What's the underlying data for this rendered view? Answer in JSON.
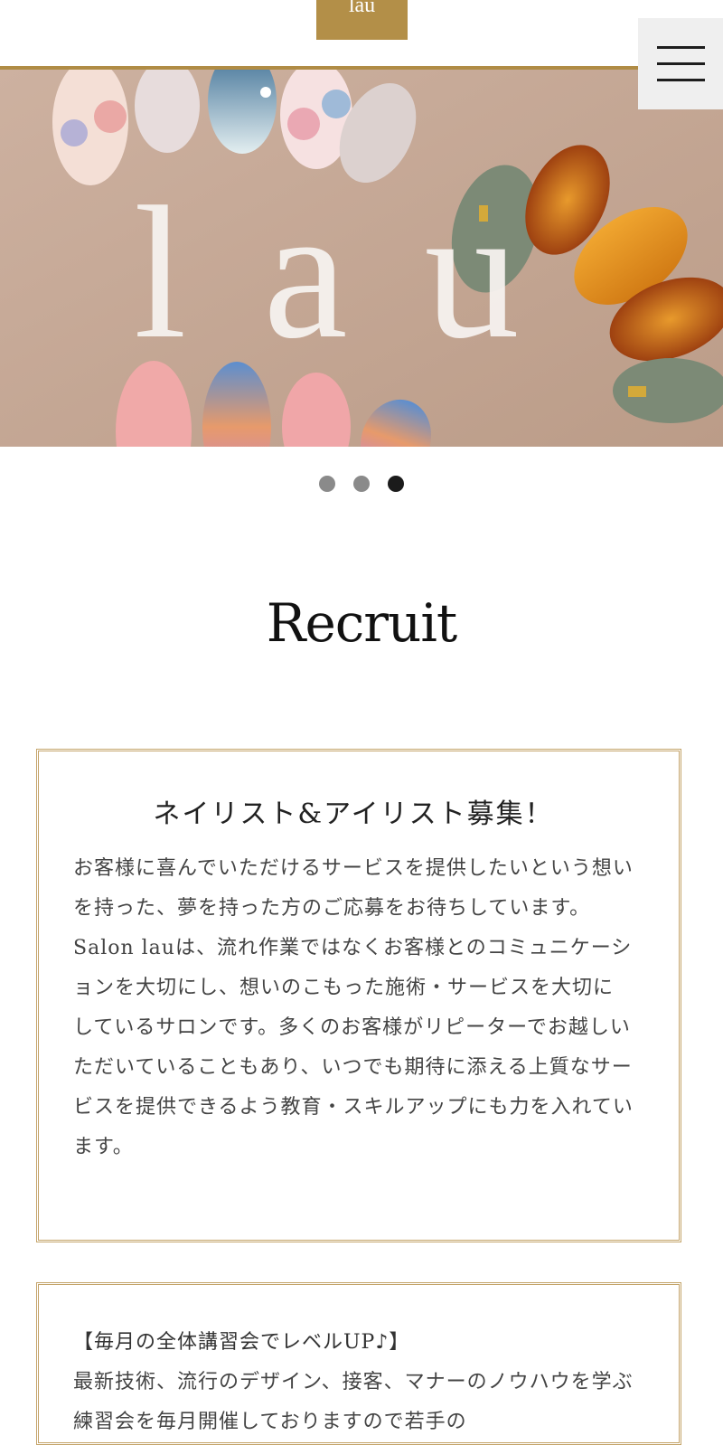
{
  "header": {
    "logo_text": "lau",
    "menu_label": "menu",
    "menu_icon": "hamburger-icon",
    "accent_color": "#b08c45"
  },
  "hero": {
    "image_text": "lau",
    "icon": "nail-art-photo"
  },
  "slider": {
    "dots": 3,
    "active_index": 2
  },
  "recruit": {
    "title": "Recruit",
    "card1": {
      "title": "ネイリスト&アイリスト募集！",
      "body": "お客様に喜んでいただけるサービスを提供したいという想いを持った、夢を持った方のご応募をお待ちしています。Salon lauは、流れ作業ではなくお客様とのコミュニケーションを大切にし、想いのこもった施術・サービスを大切にしているサロンです。多くのお客様がリピーターでお越しいただいていることもあり、いつでも期待に添える上質なサービスを提供できるよう教育・スキルアップにも力を入れています。"
    },
    "card2": {
      "heading": "【毎月の全体講習会でレベルUP♪】",
      "body": "最新技術、流行のデザイン、接客、マナーのノウハウを学ぶ練習会を毎月開催しておりますので若手の"
    }
  }
}
